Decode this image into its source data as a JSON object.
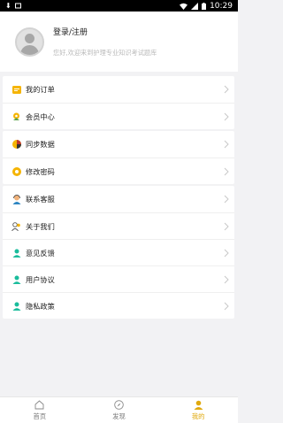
{
  "status_bar": {
    "time": "10:29"
  },
  "profile": {
    "login_label": "登录/注册",
    "welcome_text": "您好,欢迎来到护理专业知识考试题库"
  },
  "menu": {
    "group1": [
      {
        "label": "我的订单",
        "icon": "order-icon"
      },
      {
        "label": "会员中心",
        "icon": "member-icon"
      }
    ],
    "group2": [
      {
        "label": "同步数据",
        "icon": "sync-icon"
      },
      {
        "label": "修改密码",
        "icon": "password-icon"
      }
    ],
    "group3": [
      {
        "label": "联系客服",
        "icon": "customer-service-icon"
      },
      {
        "label": "关于我们",
        "icon": "about-icon"
      },
      {
        "label": "意见反馈",
        "icon": "feedback-icon"
      },
      {
        "label": "用户协议",
        "icon": "agreement-icon"
      },
      {
        "label": "隐私政策",
        "icon": "privacy-icon"
      }
    ]
  },
  "tabbar": {
    "tabs": [
      {
        "label": "首页",
        "icon": "home-icon"
      },
      {
        "label": "发现",
        "icon": "compass-icon"
      },
      {
        "label": "我的",
        "icon": "user-icon"
      }
    ],
    "active_color": "#e0a90e"
  }
}
